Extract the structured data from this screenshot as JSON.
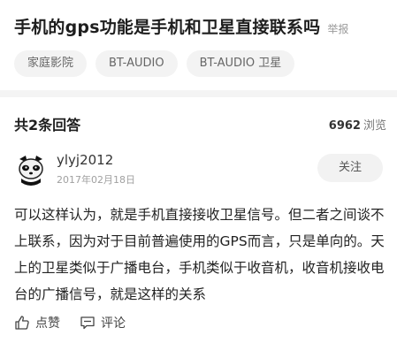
{
  "question": {
    "title": "手机的gps功能是手机和卫星直接联系吗",
    "report_label": "举报",
    "tags": [
      "家庭影院",
      "BT-AUDIO",
      "BT-AUDIO 卫星"
    ]
  },
  "answers_header": {
    "count_label": "共2条回答",
    "views_count": "6962",
    "views_label": "浏览"
  },
  "answer": {
    "username": "ylyj2012",
    "date": "2017年02月18日",
    "follow_label": "关注",
    "content": "可以这样认为，就是手机直接接收卫星信号。但二者之间谈不上联系，因为对于目前普遍使用的GPS而言，只是单向的。天上的卫星类似于广播电台，手机类似于收音机，收音机接收电台的广播信号，就是这样的关系",
    "like_label": "点赞",
    "comment_label": "评论",
    "like_icon": "thumbs-up-icon",
    "comment_icon": "comment-icon"
  }
}
